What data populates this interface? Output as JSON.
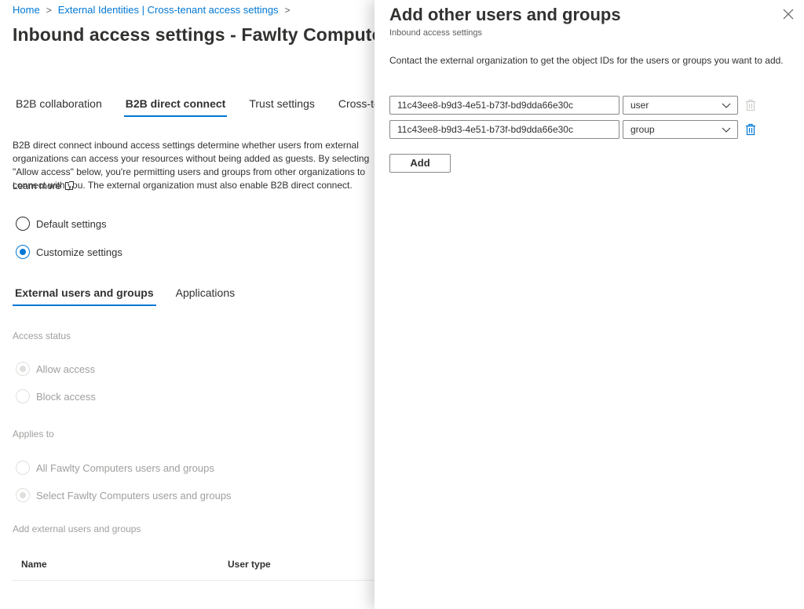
{
  "breadcrumb": {
    "home": "Home",
    "item2": "External Identities | Cross-tenant access settings"
  },
  "page_title": "Inbound access settings - Fawlty Computers",
  "tabs": [
    {
      "label": "B2B collaboration",
      "active": false
    },
    {
      "label": "B2B direct connect",
      "active": true
    },
    {
      "label": "Trust settings",
      "active": false
    },
    {
      "label": "Cross-tenant sync",
      "active": false
    }
  ],
  "description": "B2B direct connect inbound access settings determine whether users from external organizations can access your resources without being added as guests. By selecting \"Allow access\" below, you're permitting users and groups from other organizations to connect with you. The external organization must also enable B2B direct connect.",
  "learn_more": "Learn more",
  "settings_mode": {
    "default_label": "Default settings",
    "customize_label": "Customize settings",
    "selected": "customize"
  },
  "subtabs": [
    {
      "label": "External users and groups",
      "active": true
    },
    {
      "label": "Applications",
      "active": false
    }
  ],
  "access_status": {
    "label": "Access status",
    "allow_label": "Allow access",
    "block_label": "Block access",
    "selected": "allow"
  },
  "applies_to": {
    "label": "Applies to",
    "all_label": "All Fawlty Computers users and groups",
    "select_label": "Select Fawlty Computers users and groups",
    "selected": "select"
  },
  "add_section_label": "Add external users and groups",
  "table": {
    "columns": [
      "Name",
      "User type"
    ]
  },
  "panel": {
    "title": "Add other users and groups",
    "subtitle": "Inbound access settings",
    "description": "Contact the external organization to get the object IDs for the users or groups you want to add.",
    "entries": [
      {
        "object_id": "11c43ee8-b9d3-4e51-b73f-bd9dda66e30c",
        "type": "user",
        "delete_enabled": false
      },
      {
        "object_id": "11c43ee8-b9d3-4e51-b73f-bd9dda66e30c",
        "type": "group",
        "delete_enabled": true
      }
    ],
    "add_button": "Add"
  },
  "colors": {
    "accent": "#0078d4",
    "text": "#323130",
    "disabled": "#a19f9d"
  }
}
